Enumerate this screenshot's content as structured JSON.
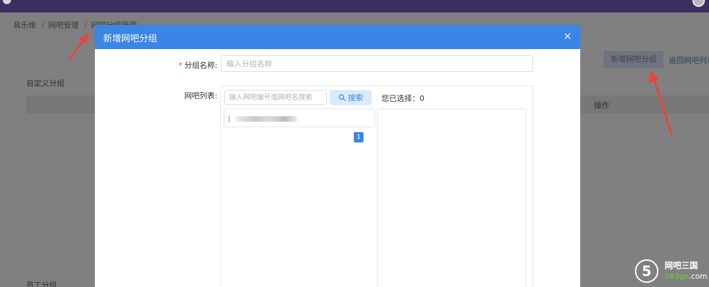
{
  "breadcrumb": [
    "易乐维",
    "网吧管理",
    "网吧分组管理"
  ],
  "background": {
    "custom_group_label": "自定义分组",
    "operation_header": "操作",
    "add_button": "新增网吧分组",
    "back_link": "返回网吧列表",
    "staff_group_label": "员工分组"
  },
  "modal": {
    "title": "新增网吧分组",
    "close": "×",
    "name_label": "分组名称:",
    "name_placeholder": "输入分组名称",
    "list_label": "网吧列表:",
    "search_placeholder": "输入网吧编号或网吧名搜索",
    "search_button": "搜索",
    "selected_text": "您已选择：0",
    "page_number": "1"
  },
  "watermark": {
    "badge": "5",
    "line1": "网吧三国",
    "line2_a": "583go",
    "line2_b": ".com"
  },
  "colors": {
    "primary": "#3a85e6",
    "required": "#e24545",
    "annotation_arrow": "#e8453c"
  },
  "icons": [
    "search-icon",
    "close-icon",
    "annotation-arrow"
  ]
}
